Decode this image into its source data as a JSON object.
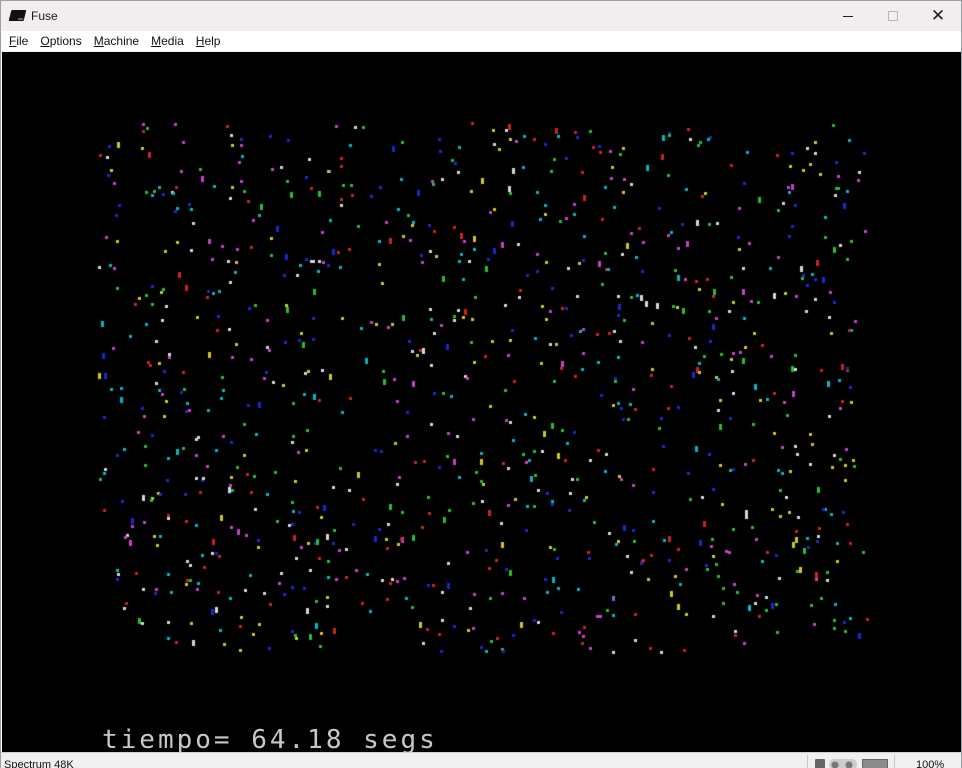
{
  "window": {
    "title": "Fuse",
    "controls": [
      "minimize",
      "maximize",
      "close"
    ],
    "close_glyph": "✕"
  },
  "menubar": {
    "items": [
      "File",
      "Options",
      "Machine",
      "Media",
      "Help"
    ]
  },
  "display": {
    "timer_text": "tiempo= 64.18 segs",
    "background_color": "#000000",
    "pixel_colors": [
      "#d6d6d6",
      "#c840c8",
      "#00b8c8",
      "#d0c820",
      "#20c030",
      "#d02020",
      "#1828d0"
    ]
  },
  "statusbar": {
    "model": "Spectrum 48K",
    "zoom": "100%",
    "icons": [
      "tape-icon",
      "disk-icon",
      "pc-icon"
    ]
  }
}
